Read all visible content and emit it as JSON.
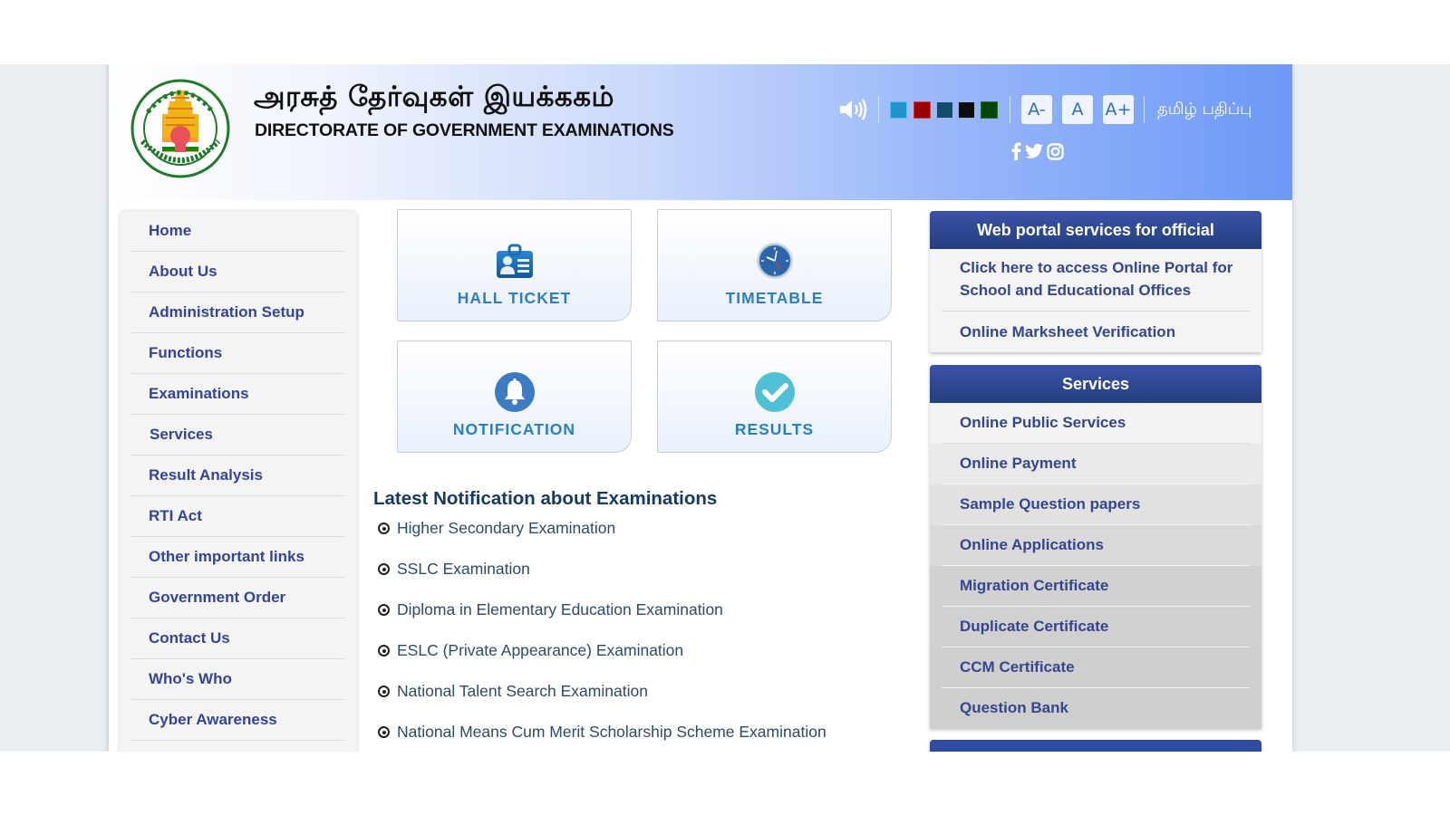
{
  "header": {
    "title_tamil": "அரசுத் தேர்வுகள் இயக்ககம்",
    "title_english": "DIRECTORATE OF GOVERNMENT EXAMINATIONS",
    "logo_icon": "tamil-nadu-emblem-icon",
    "screen_reader_icon": "speaker-icon",
    "color_themes": [
      "#1e94cf",
      "#9a0000",
      "#134d6b",
      "#0d0d0d",
      "#064506"
    ],
    "font_buttons": [
      "A-",
      "A",
      "A+"
    ],
    "language_link": "தமிழ் பதிப்பு",
    "social_icons": [
      "facebook-icon",
      "twitter-icon",
      "instagram-icon"
    ]
  },
  "left_nav": {
    "items": [
      "Home",
      "About Us",
      "Administration Setup",
      "Functions",
      "Examinations",
      "Services",
      "Result Analysis",
      "RTI Act",
      "Other important links",
      "Government Order",
      "Contact Us",
      "Who's Who",
      "Cyber Awareness"
    ]
  },
  "tiles": [
    {
      "label": "HALL TICKET",
      "icon": "id-card-icon"
    },
    {
      "label": "TIMETABLE",
      "icon": "clock-icon"
    },
    {
      "label": "NOTIFICATION",
      "icon": "bell-icon"
    },
    {
      "label": "RESULTS",
      "icon": "check-circle-icon"
    }
  ],
  "notifications": {
    "heading": "Latest Notification about Examinations",
    "items": [
      "Higher Secondary Examination",
      "SSLC Examination",
      "Diploma in Elementary Education Examination",
      "ESLC (Private Appearance) Examination",
      "National Talent Search Examination",
      "National Means Cum Merit Scholarship Scheme Examination"
    ]
  },
  "official_portal": {
    "heading": "Web portal services for official",
    "items": [
      "Click here to access Online Portal for School and Educational Offices",
      "Online Marksheet Verification"
    ]
  },
  "services": {
    "heading": "Services",
    "items": [
      "Online Public Services",
      "Online Payment",
      "Sample Question papers",
      "Online Applications",
      "Migration Certificate",
      "Duplicate Certificate",
      "CCM Certificate",
      "Question Bank"
    ]
  },
  "colors": {
    "nav_text": "#33449a",
    "panel_header": "#2a4690",
    "tile_label": "#2a7fc6",
    "heading": "#163a66"
  }
}
